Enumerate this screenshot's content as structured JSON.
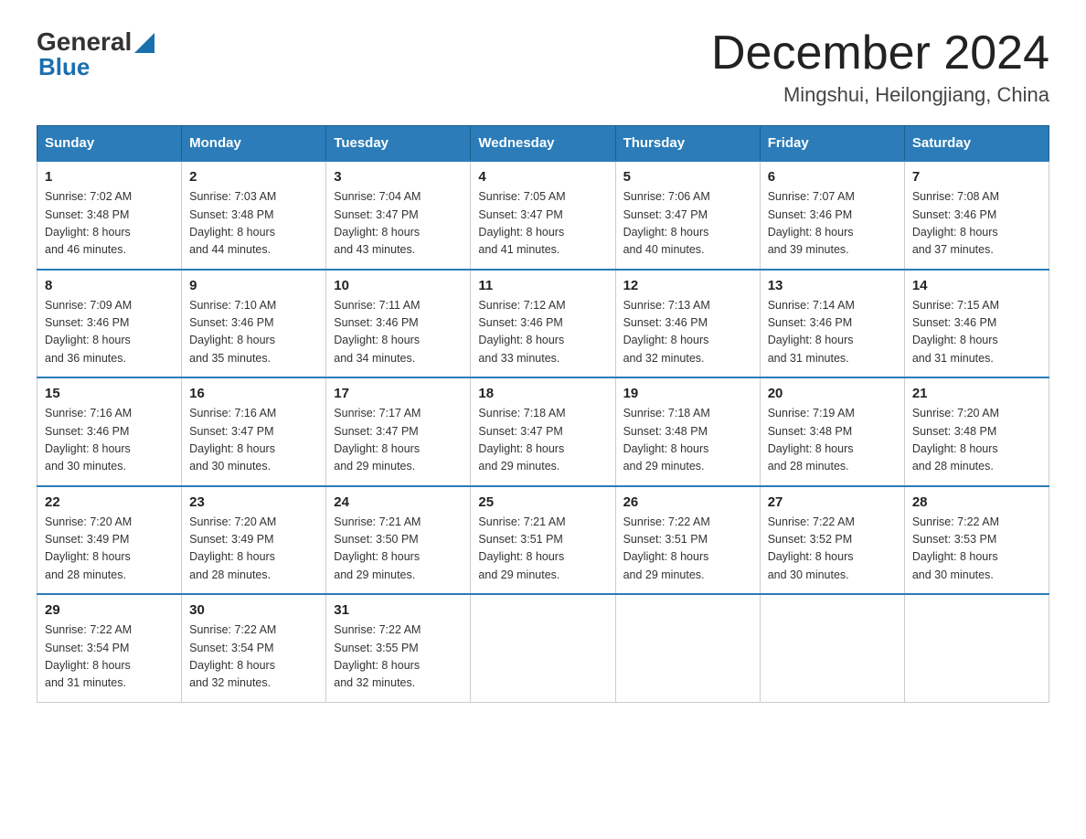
{
  "header": {
    "title": "December 2024",
    "subtitle": "Mingshui, Heilongjiang, China",
    "logo_general": "General",
    "logo_blue": "Blue"
  },
  "columns": [
    "Sunday",
    "Monday",
    "Tuesday",
    "Wednesday",
    "Thursday",
    "Friday",
    "Saturday"
  ],
  "weeks": [
    [
      {
        "day": "1",
        "sunrise": "7:02 AM",
        "sunset": "3:48 PM",
        "daylight": "8 hours and 46 minutes."
      },
      {
        "day": "2",
        "sunrise": "7:03 AM",
        "sunset": "3:48 PM",
        "daylight": "8 hours and 44 minutes."
      },
      {
        "day": "3",
        "sunrise": "7:04 AM",
        "sunset": "3:47 PM",
        "daylight": "8 hours and 43 minutes."
      },
      {
        "day": "4",
        "sunrise": "7:05 AM",
        "sunset": "3:47 PM",
        "daylight": "8 hours and 41 minutes."
      },
      {
        "day": "5",
        "sunrise": "7:06 AM",
        "sunset": "3:47 PM",
        "daylight": "8 hours and 40 minutes."
      },
      {
        "day": "6",
        "sunrise": "7:07 AM",
        "sunset": "3:46 PM",
        "daylight": "8 hours and 39 minutes."
      },
      {
        "day": "7",
        "sunrise": "7:08 AM",
        "sunset": "3:46 PM",
        "daylight": "8 hours and 37 minutes."
      }
    ],
    [
      {
        "day": "8",
        "sunrise": "7:09 AM",
        "sunset": "3:46 PM",
        "daylight": "8 hours and 36 minutes."
      },
      {
        "day": "9",
        "sunrise": "7:10 AM",
        "sunset": "3:46 PM",
        "daylight": "8 hours and 35 minutes."
      },
      {
        "day": "10",
        "sunrise": "7:11 AM",
        "sunset": "3:46 PM",
        "daylight": "8 hours and 34 minutes."
      },
      {
        "day": "11",
        "sunrise": "7:12 AM",
        "sunset": "3:46 PM",
        "daylight": "8 hours and 33 minutes."
      },
      {
        "day": "12",
        "sunrise": "7:13 AM",
        "sunset": "3:46 PM",
        "daylight": "8 hours and 32 minutes."
      },
      {
        "day": "13",
        "sunrise": "7:14 AM",
        "sunset": "3:46 PM",
        "daylight": "8 hours and 31 minutes."
      },
      {
        "day": "14",
        "sunrise": "7:15 AM",
        "sunset": "3:46 PM",
        "daylight": "8 hours and 31 minutes."
      }
    ],
    [
      {
        "day": "15",
        "sunrise": "7:16 AM",
        "sunset": "3:46 PM",
        "daylight": "8 hours and 30 minutes."
      },
      {
        "day": "16",
        "sunrise": "7:16 AM",
        "sunset": "3:47 PM",
        "daylight": "8 hours and 30 minutes."
      },
      {
        "day": "17",
        "sunrise": "7:17 AM",
        "sunset": "3:47 PM",
        "daylight": "8 hours and 29 minutes."
      },
      {
        "day": "18",
        "sunrise": "7:18 AM",
        "sunset": "3:47 PM",
        "daylight": "8 hours and 29 minutes."
      },
      {
        "day": "19",
        "sunrise": "7:18 AM",
        "sunset": "3:48 PM",
        "daylight": "8 hours and 29 minutes."
      },
      {
        "day": "20",
        "sunrise": "7:19 AM",
        "sunset": "3:48 PM",
        "daylight": "8 hours and 28 minutes."
      },
      {
        "day": "21",
        "sunrise": "7:20 AM",
        "sunset": "3:48 PM",
        "daylight": "8 hours and 28 minutes."
      }
    ],
    [
      {
        "day": "22",
        "sunrise": "7:20 AM",
        "sunset": "3:49 PM",
        "daylight": "8 hours and 28 minutes."
      },
      {
        "day": "23",
        "sunrise": "7:20 AM",
        "sunset": "3:49 PM",
        "daylight": "8 hours and 28 minutes."
      },
      {
        "day": "24",
        "sunrise": "7:21 AM",
        "sunset": "3:50 PM",
        "daylight": "8 hours and 29 minutes."
      },
      {
        "day": "25",
        "sunrise": "7:21 AM",
        "sunset": "3:51 PM",
        "daylight": "8 hours and 29 minutes."
      },
      {
        "day": "26",
        "sunrise": "7:22 AM",
        "sunset": "3:51 PM",
        "daylight": "8 hours and 29 minutes."
      },
      {
        "day": "27",
        "sunrise": "7:22 AM",
        "sunset": "3:52 PM",
        "daylight": "8 hours and 30 minutes."
      },
      {
        "day": "28",
        "sunrise": "7:22 AM",
        "sunset": "3:53 PM",
        "daylight": "8 hours and 30 minutes."
      }
    ],
    [
      {
        "day": "29",
        "sunrise": "7:22 AM",
        "sunset": "3:54 PM",
        "daylight": "8 hours and 31 minutes."
      },
      {
        "day": "30",
        "sunrise": "7:22 AM",
        "sunset": "3:54 PM",
        "daylight": "8 hours and 32 minutes."
      },
      {
        "day": "31",
        "sunrise": "7:22 AM",
        "sunset": "3:55 PM",
        "daylight": "8 hours and 32 minutes."
      },
      null,
      null,
      null,
      null
    ]
  ],
  "labels": {
    "sunrise": "Sunrise:",
    "sunset": "Sunset:",
    "daylight": "Daylight:"
  }
}
